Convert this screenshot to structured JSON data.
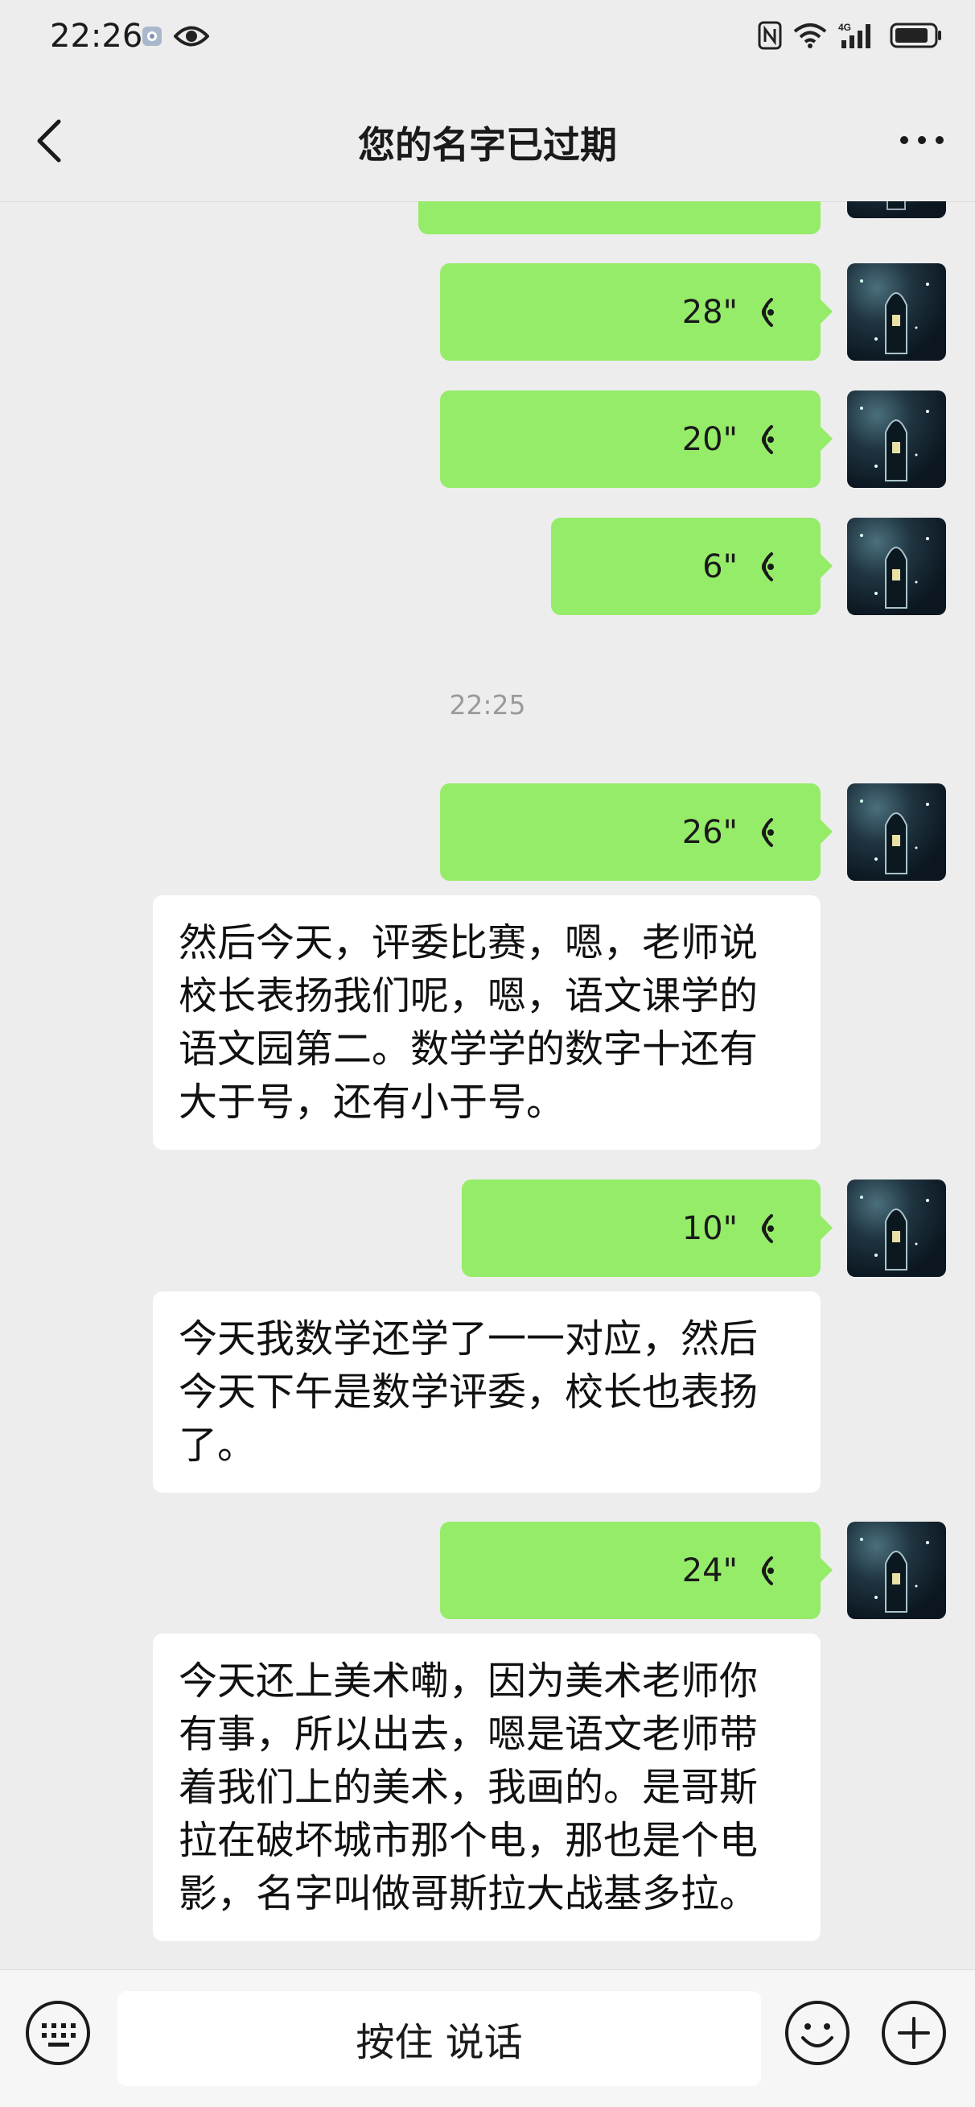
{
  "status_bar": {
    "time": "22:26",
    "left_icons": [
      "app-notification-icon",
      "eye-icon"
    ],
    "right_icons": [
      "nfc-icon",
      "wifi-icon",
      "signal-4g-icon",
      "battery-icon"
    ]
  },
  "nav": {
    "title": "您的名字已过期",
    "back_icon": "chevron-left-icon",
    "more_icon": "more-dots-icon"
  },
  "chat": {
    "timestamp": "22:25",
    "voice_messages": [
      {
        "duration": ""
      },
      {
        "duration": "28\""
      },
      {
        "duration": "20\""
      },
      {
        "duration": "6\""
      },
      {
        "duration": "26\""
      },
      {
        "duration": "10\""
      },
      {
        "duration": "24\""
      }
    ],
    "text_messages": [
      {
        "text": "然后今天，评委比赛，嗯，老师说校长表扬我们呢，嗯，语文课学的语文园第二。数学学的数字十还有大于号，还有小于号。"
      },
      {
        "text": "今天我数学还学了一一对应，然后今天下午是数学评委，校长也表扬了。"
      },
      {
        "text": "今天还上美术嘞，因为美术老师你有事，所以出去，嗯是语文老师带着我们上的美术，我画的。是哥斯拉在破坏城市那个电，那也是个电影，名字叫做哥斯拉大战基多拉。"
      }
    ]
  },
  "input_bar": {
    "hold_to_talk_label": "按住 说话",
    "icons": [
      "keyboard-icon",
      "emoji-icon",
      "plus-icon"
    ]
  },
  "colors": {
    "background": "#ededed",
    "sent_bubble": "#95ec69",
    "received_bubble": "#ffffff"
  }
}
